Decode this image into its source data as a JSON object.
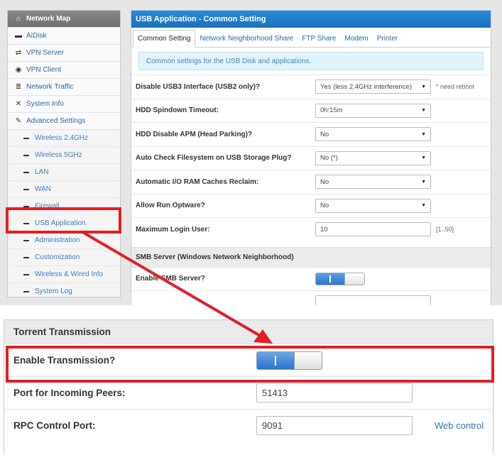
{
  "sidebar": {
    "items": [
      {
        "label": "Network Map",
        "icon": "home-icon",
        "glyph": "⌂"
      },
      {
        "label": "AiDisk",
        "icon": "disk-icon",
        "glyph": "▬"
      },
      {
        "label": "VPN Server",
        "icon": "swap-icon",
        "glyph": "⇄"
      },
      {
        "label": "VPN Client",
        "icon": "globe-icon",
        "glyph": "◉"
      },
      {
        "label": "Network Traffic",
        "icon": "list-icon",
        "glyph": "≣"
      },
      {
        "label": "System Info",
        "icon": "shuffle-icon",
        "glyph": "✕"
      },
      {
        "label": "Advanced Settings",
        "icon": "wrench-icon",
        "glyph": "✎"
      }
    ],
    "subitems": [
      {
        "label": "Wireless 2.4GHz"
      },
      {
        "label": "Wireless 5GHz"
      },
      {
        "label": "LAN"
      },
      {
        "label": "WAN"
      },
      {
        "label": "Firewall"
      },
      {
        "label": "USB Application"
      },
      {
        "label": "Administration"
      },
      {
        "label": "Customization"
      },
      {
        "label": "Wireless & Wired Info"
      },
      {
        "label": "System Log"
      }
    ]
  },
  "panel": {
    "title": "USB Application - Common Setting",
    "tabs": [
      "Common Setting",
      "Network Neighborhood Share",
      "FTP Share",
      "Modem",
      "Printer"
    ],
    "info": "Common settings for the USB Disk and applications.",
    "rows": [
      {
        "label": "Disable USB3 Interface (USB2 only)?",
        "type": "select",
        "value": "Yes (less 2.4GHz interference)",
        "note": "* need reboot"
      },
      {
        "label": "HDD Spindown Timeout:",
        "type": "select",
        "value": "0h:15m",
        "note": ""
      },
      {
        "label": "HDD Disable APM (Head Parking)?",
        "type": "select",
        "value": "No",
        "note": ""
      },
      {
        "label": "Auto Check Filesystem on USB Storage Plug?",
        "type": "select",
        "value": "No (*)",
        "note": ""
      },
      {
        "label": "Automatic I/O RAM Caches Reclaim:",
        "type": "select",
        "value": "No",
        "note": ""
      },
      {
        "label": "Allow Run Optware?",
        "type": "select",
        "value": "No",
        "note": ""
      },
      {
        "label": "Maximum Login User:",
        "type": "input",
        "value": "10",
        "note": "[1..50]"
      }
    ],
    "smb_section": "SMB Server (Windows Network Neighborhood)",
    "smb_enable_label": "Enable SMB Server?",
    "smb_enable_state": "on"
  },
  "transmission": {
    "section": "Torrent Transmission",
    "enable_label": "Enable Transmission?",
    "enable_state": "on",
    "port_label": "Port for Incoming Peers:",
    "port_value": "51413",
    "rpc_label": "RPC Control Port:",
    "rpc_value": "9091",
    "web_control": "Web control"
  },
  "colors": {
    "highlight": "#e31e25",
    "header_blue": "#1b6fbf",
    "link_blue": "#2b67ad"
  }
}
